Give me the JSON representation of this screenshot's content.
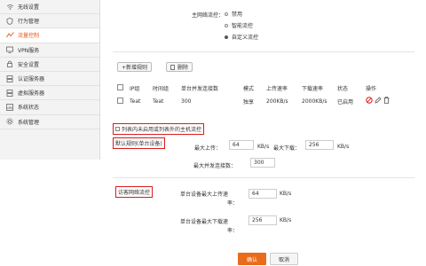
{
  "sidebar": {
    "items": [
      {
        "label": "无线设置",
        "icon": "wifi-icon"
      },
      {
        "label": "行为管理",
        "icon": "shield-icon"
      },
      {
        "label": "流量控制",
        "icon": "traffic-icon",
        "active": true
      },
      {
        "label": "VPN服务",
        "icon": "vpn-icon"
      },
      {
        "label": "安全设置",
        "icon": "lock-icon"
      },
      {
        "label": "认证服务器",
        "icon": "server-icon"
      },
      {
        "label": "虚拟服务器",
        "icon": "server-icon"
      },
      {
        "label": "系统状态",
        "icon": "status-icon"
      },
      {
        "label": "系统管理",
        "icon": "settings-icon"
      }
    ]
  },
  "flow_control": {
    "label": "主网络流控：",
    "options": [
      "禁用",
      "智能流控",
      "自定义流控"
    ],
    "selected_index": 2
  },
  "toolbar": {
    "add_rule": "+新增规则",
    "delete": "删除"
  },
  "table": {
    "headers": [
      "IP组",
      "时间组",
      "单台并发连接数",
      "模式",
      "上传速率",
      "下载速率",
      "状态",
      "操作"
    ],
    "rows": [
      {
        "ip_group": "Teat",
        "time_group": "Teat",
        "connections": "300",
        "mode": "独享",
        "upload": "200KB/s",
        "download": "2000KB/s",
        "status": "已启用"
      }
    ]
  },
  "whitelist_checkbox": "列表内未启用或列表外的主机流控",
  "default_rule": {
    "title": "默认规则(单台设备)",
    "max_upload_label": "最大上传：",
    "max_upload_value": "64",
    "unit_kbs": "KB/s",
    "max_download_label": "最大下载：",
    "max_download_value": "256",
    "max_conn_label": "最大并发连接数：",
    "max_conn_value": "300"
  },
  "guest_rule": {
    "title": "访客网络流控",
    "upload_label_1": "单台设备最大上传速",
    "upload_label_2": "率：",
    "upload_value": "64",
    "download_label_1": "单台设备最大下载速",
    "download_label_2": "率：",
    "download_value": "256",
    "unit_kbs": "KB/s"
  },
  "footer": {
    "confirm": "确认",
    "cancel": "取消"
  },
  "colors": {
    "accent": "#e95513",
    "highlight_border": "#d91c1c",
    "confirm": "#e96b1c"
  }
}
